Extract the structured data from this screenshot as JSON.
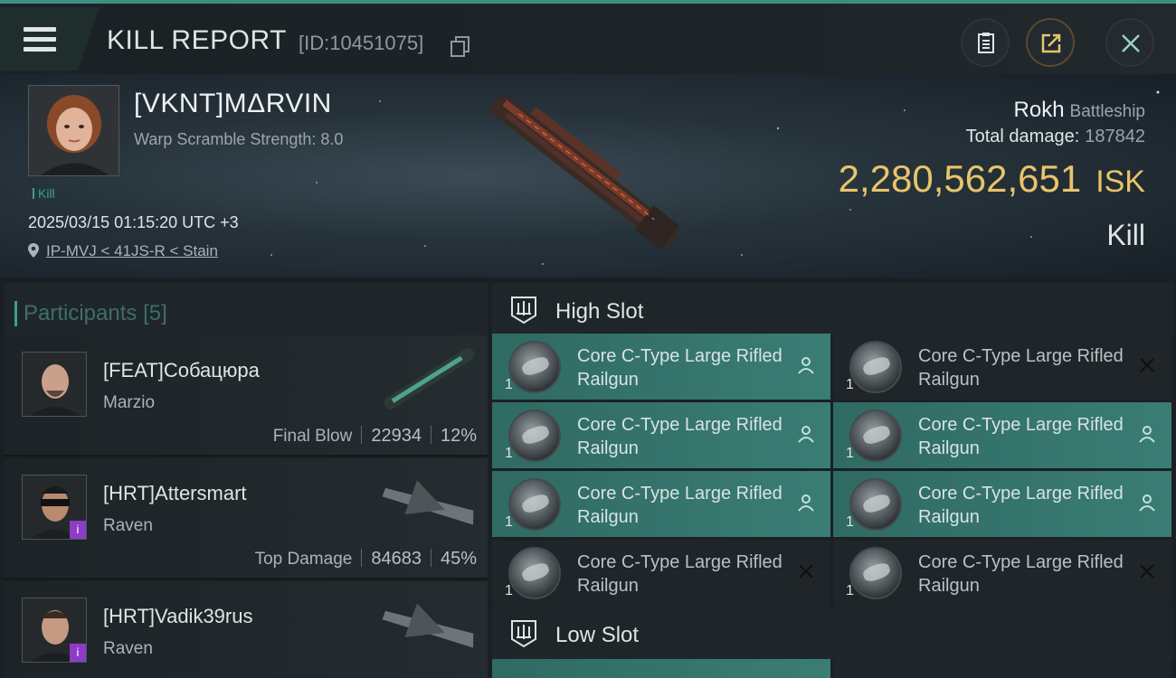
{
  "header": {
    "title": "KILL REPORT",
    "report_id": "[ID:10451075]",
    "icons": {
      "menu": "hamburger-menu-icon",
      "copy": "copy-icon",
      "clipboard": "clipboard-icon",
      "share": "share-icon",
      "close": "close-icon"
    }
  },
  "victim": {
    "name": "[VKNT]MΔRVIN",
    "warp_scramble": "Warp Scramble Strength: 8.0",
    "tag": "Kill",
    "datetime": "2025/03/15 01:15:20 UTC +3",
    "location": "IP-MVJ < 41JS-R < Stain",
    "ship_name": "Rokh",
    "ship_class": "Battleship",
    "damage_label": "Total damage:",
    "damage_value": "187842",
    "isk_amount": "2,280,562,651",
    "isk_currency": "ISK",
    "result": "Kill"
  },
  "participants": {
    "label": "Participants",
    "count": "[5]",
    "rows": [
      {
        "name": "[FEAT]Собацюра",
        "ship": "Marzio",
        "role": "Final Blow",
        "damage": "22934",
        "percent": "12%",
        "badge": ""
      },
      {
        "name": "[HRT]Attersmart",
        "ship": "Raven",
        "role": "Top Damage",
        "damage": "84683",
        "percent": "45%",
        "badge": "i"
      },
      {
        "name": "[HRT]Vadik39rus",
        "ship": "Raven",
        "role": "",
        "damage": "",
        "percent": "",
        "badge": "i"
      }
    ]
  },
  "slots": {
    "high_label": "High Slot",
    "low_label": "Low Slot",
    "modules": [
      {
        "name": "Core C-Type Large Rifled Railgun",
        "qty": "1",
        "state": "person-icon"
      },
      {
        "name": "Core C-Type Large Rifled Railgun",
        "qty": "1",
        "state": "destroyed-x-icon"
      },
      {
        "name": "Core C-Type Large Rifled Railgun",
        "qty": "1",
        "state": "person-icon"
      },
      {
        "name": "Core C-Type Large Rifled Railgun",
        "qty": "1",
        "state": "person-icon"
      },
      {
        "name": "Core C-Type Large Rifled Railgun",
        "qty": "1",
        "state": "person-icon"
      },
      {
        "name": "Core C-Type Large Rifled Railgun",
        "qty": "1",
        "state": "person-icon"
      },
      {
        "name": "Core C-Type Large Rifled Railgun",
        "qty": "1",
        "state": "destroyed-x-icon"
      },
      {
        "name": "Core C-Type Large Rifled Railgun",
        "qty": "1",
        "state": "destroyed-x-icon"
      }
    ]
  },
  "colors": {
    "accent": "#3aa08c",
    "isk": "#e8c46a",
    "slot_active": "#3a7d74",
    "badge": "#8e3cc7"
  }
}
